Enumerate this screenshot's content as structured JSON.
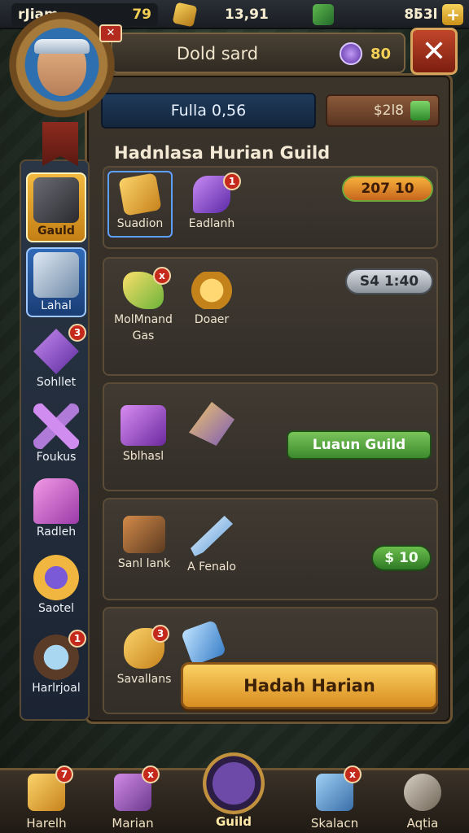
{
  "resources": [
    {
      "name": "player",
      "label": "rJiam",
      "value": "79"
    },
    {
      "name": "gold",
      "value": "13,91"
    },
    {
      "name": "gems",
      "value": "8l"
    },
    {
      "name": "extra",
      "value": "53l"
    }
  ],
  "header": {
    "title": "Dold sard",
    "currency_value": "80",
    "close_symbol": "✕",
    "avatar_badge": "✕"
  },
  "info_bar": {
    "text": "Fulla 0,56"
  },
  "price_bar": {
    "text": "$2l8"
  },
  "section_title": "Hadnlasa Hurian Guild",
  "cards": [
    {
      "items": [
        {
          "label": "Suadion"
        },
        {
          "label": "Eadlanh",
          "badge": "1"
        }
      ],
      "pill": "207 10"
    },
    {
      "items": [
        {
          "label": "MolMnand\nGas",
          "badge": "x"
        },
        {
          "label": "Doaer"
        }
      ],
      "pill": "S4 1:40"
    },
    {
      "items": [
        {
          "label": "Sblhasl"
        },
        {
          "label": ""
        }
      ],
      "button": "Luaun Guild"
    },
    {
      "items": [
        {
          "label": "Sanl lank"
        },
        {
          "label": "A Fenalo"
        }
      ],
      "pill": "$ 10"
    },
    {
      "items": [
        {
          "label": "Savallans",
          "badge": "3"
        },
        {
          "label": ""
        }
      ],
      "button": "Hadah Harian"
    }
  ],
  "sidebar": [
    {
      "label": "Gauld",
      "active": true
    },
    {
      "label": "Lahal"
    },
    {
      "label": "Sohllet",
      "badge": "3"
    },
    {
      "label": "Foukus"
    },
    {
      "label": "Radleh"
    },
    {
      "label": "Saotel"
    },
    {
      "label": "Harlrjoal",
      "badge": "1"
    }
  ],
  "bottom_nav": [
    {
      "label": "Harelh",
      "badge": "7"
    },
    {
      "label": "Marian",
      "badge": "x"
    },
    {
      "label": "Guild"
    },
    {
      "label": "Skalacn",
      "badge": "x"
    },
    {
      "label": "Aqtia"
    }
  ]
}
